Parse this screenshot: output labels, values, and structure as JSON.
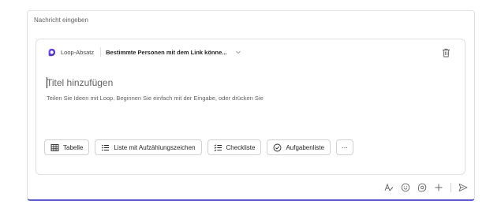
{
  "composer": {
    "placeholder": "Nachricht eingeben"
  },
  "loop": {
    "app_label": "Loop-Absatz",
    "permission_label": "Bestimmte Personen mit dem Link könne...",
    "title_placeholder": "Titel hinzufügen",
    "hint": "Teilen Sie Ideen mit Loop. Beginnen Sie einfach mit der Eingabe, oder drücken Sie",
    "accent": "#5b5fc7"
  },
  "chips": [
    {
      "label": "Tabelle",
      "icon": "table-icon"
    },
    {
      "label": "Liste mit Aufzählungszeichen",
      "icon": "bulleted-list-icon"
    },
    {
      "label": "Checkliste",
      "icon": "checklist-icon"
    },
    {
      "label": "Aufgabenliste",
      "icon": "task-list-icon"
    },
    {
      "label": "···",
      "icon": "more-icon"
    }
  ],
  "toolbar": {
    "icons": [
      "format-icon",
      "emoji-icon",
      "loop-component-icon",
      "add-icon",
      "send-icon"
    ]
  }
}
